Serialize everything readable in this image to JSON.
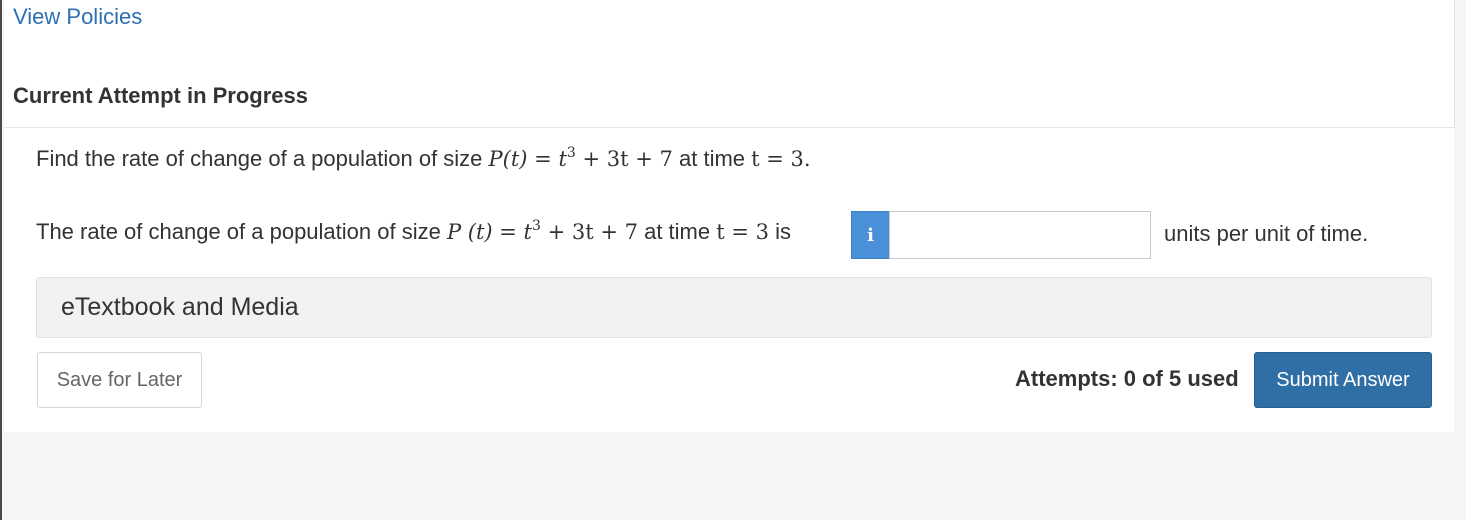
{
  "header": {
    "view_policies_link": "View Policies",
    "attempt_heading": "Current Attempt in Progress"
  },
  "question": {
    "prompt_prefix": "Find the rate of change of a population of size ",
    "prompt_function": "P(t)",
    "prompt_equals": " = ",
    "prompt_expression_t": "t",
    "prompt_expression_exp": "3",
    "prompt_expression_rest": " + 3t + 7",
    "prompt_middle": " at time ",
    "prompt_time": "t = 3.",
    "answer_prefix": "The rate of change of a population of size ",
    "answer_function": "P (t)",
    "answer_equals": " = ",
    "answer_expression_t": "t",
    "answer_expression_exp": "3",
    "answer_expression_rest": " + 3t + 7",
    "answer_middle": " at time ",
    "answer_time": "t = 3",
    "answer_suffix": " is",
    "info_icon_label": "i",
    "answer_value": "",
    "units_label": "units per unit of time."
  },
  "resources": {
    "etextbook_label": "eTextbook and Media"
  },
  "footer": {
    "save_label": "Save for Later",
    "attempts_text": "Attempts: 0 of 5 used",
    "submit_label": "Submit Answer"
  },
  "colors": {
    "link": "#2c6fb3",
    "info_button": "#4a90d9",
    "submit_button": "#2f6fa6"
  },
  "icons": {
    "info": "info-icon"
  }
}
